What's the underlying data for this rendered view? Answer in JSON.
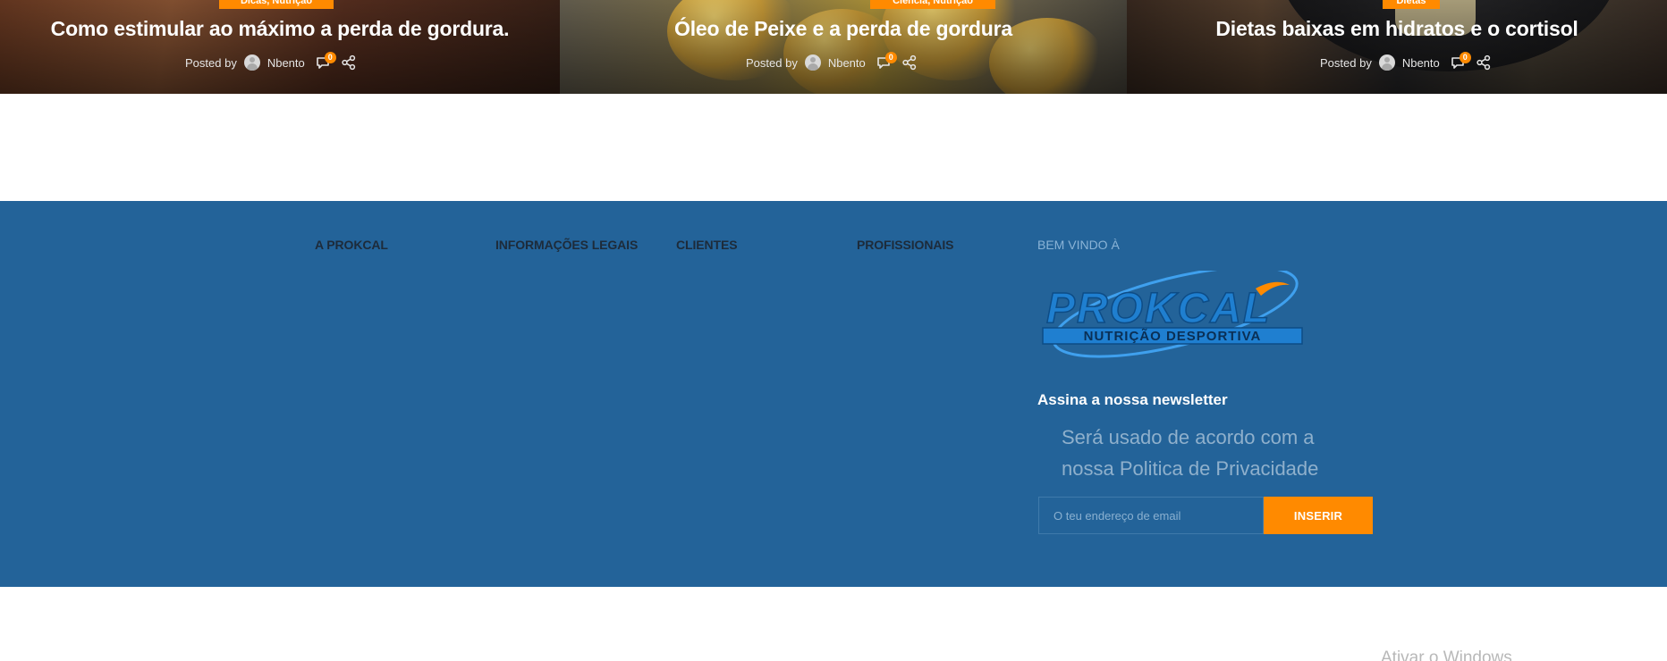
{
  "posts": [
    {
      "category": "Dicas, Nutrição",
      "title": "Como estimular ao máximo a perda de gordura.",
      "posted_by": "Posted by",
      "author": "Nbento",
      "comments": "0"
    },
    {
      "category": "Ciência, Nutrição",
      "title": "Óleo de Peixe e a perda de gordura",
      "posted_by": "Posted by",
      "author": "Nbento",
      "comments": "0"
    },
    {
      "category": "Dietas",
      "title": "Dietas baixas em hidratos e o cortisol",
      "posted_by": "Posted by",
      "author": "Nbento",
      "comments": "0"
    }
  ],
  "footer": {
    "columns": [
      "A PROKCAL",
      "INFORMAÇÕES LEGAIS",
      "CLIENTES",
      "PROFISSIONAIS"
    ],
    "welcome": "BEM VINDO À",
    "logo": {
      "brand": "PROKCAL",
      "tagline": "NUTRIÇÃO DESPORTIVA",
      "primary_color": "#1f7fd0",
      "accent_color": "#ff8a00"
    },
    "newsletter_title": "Assina a nossa newsletter",
    "privacy_note": "Será usado de acordo com a nossa Politica de Privacidade",
    "email_placeholder": "O teu endereço de email",
    "submit_label": "INSERIR"
  },
  "watermark": "Ativar o Windows",
  "colors": {
    "accent": "#ff8a00",
    "footer_bg": "#236399"
  }
}
